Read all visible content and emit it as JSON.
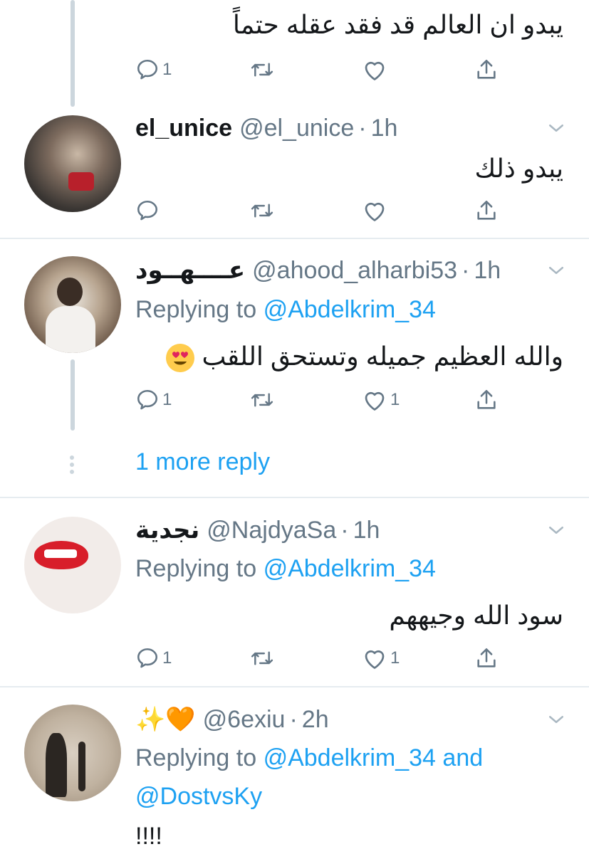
{
  "tweets": [
    {
      "text": "يبدو ان العالم قد فقد عقله حتماً",
      "reply_count": "1",
      "retweet_count": "",
      "like_count": ""
    },
    {
      "name": "el_unice",
      "handle": "@el_unice",
      "time": "1h",
      "text": "يبدو ذلك",
      "reply_count": "",
      "retweet_count": "",
      "like_count": ""
    },
    {
      "name": "عــــهــود",
      "handle": "@ahood_alharbi53",
      "time": "1h",
      "replying_label": "Replying to",
      "replying_to": "@Abdelkrim_34",
      "text": "والله العظيم جميله وتستحق اللقب",
      "reply_count": "1",
      "retweet_count": "",
      "like_count": "1"
    },
    {
      "name": "نجدية",
      "handle": "@NajdyaSa",
      "time": "1h",
      "replying_label": "Replying to",
      "replying_to": "@Abdelkrim_34",
      "text": "سود الله وجيههم",
      "reply_count": "1",
      "retweet_count": "",
      "like_count": "1"
    },
    {
      "name": "✨🧡",
      "handle": "@6exiu",
      "time": "2h",
      "replying_label": "Replying to",
      "replying_to": "@Abdelkrim_34",
      "replying_and": "and",
      "replying_to_2": "@DostvsKy",
      "text": "!!!!"
    }
  ],
  "more_replies": "1 more reply",
  "colors": {
    "accent": "#1da1f2",
    "secondary": "#657786",
    "divider": "#e6ecf0",
    "thread": "#ccd6dd"
  },
  "icons": [
    "reply-icon",
    "retweet-icon",
    "like-icon",
    "share-icon",
    "chevron-down-icon"
  ]
}
